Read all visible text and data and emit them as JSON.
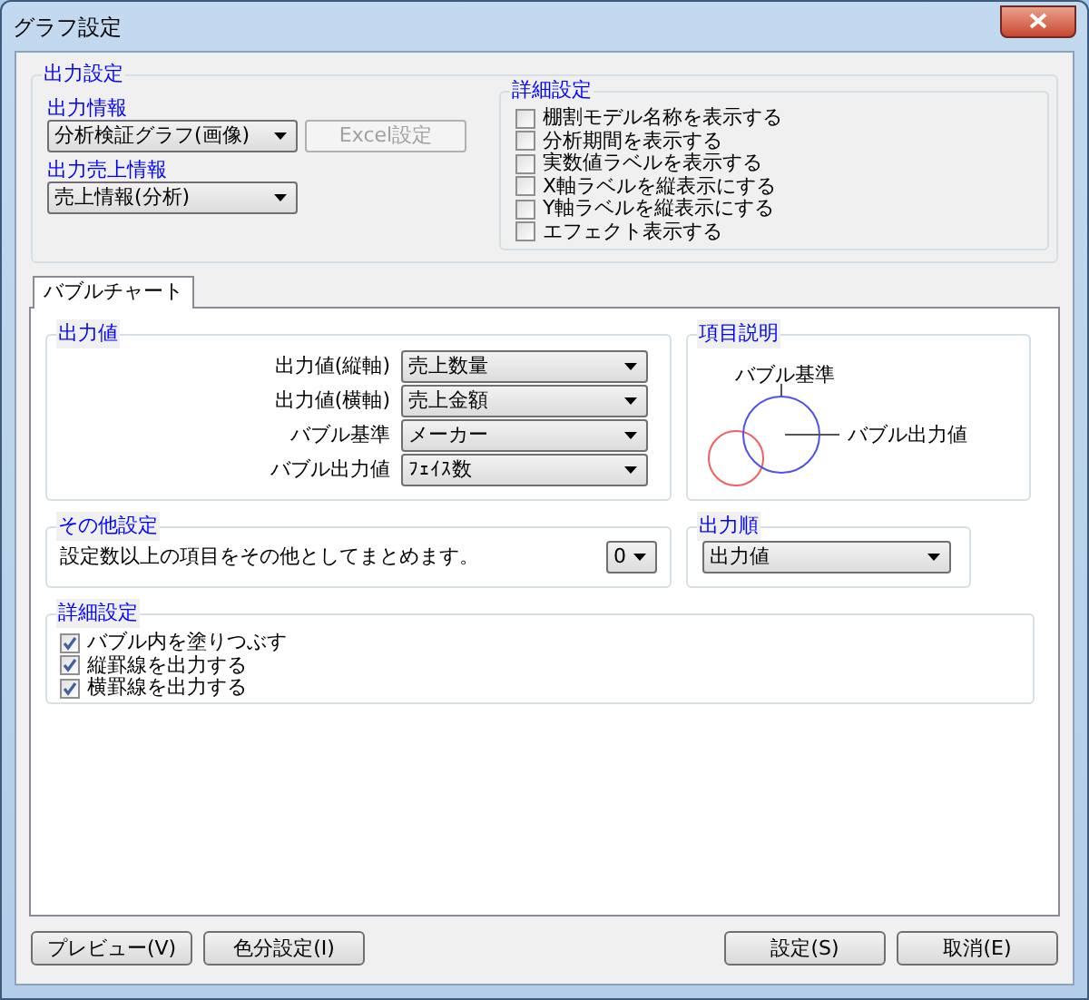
{
  "window": {
    "title": "グラフ設定"
  },
  "output_settings": {
    "title": "出力設定",
    "output_info": {
      "label": "出力情報",
      "value": "分析検証グラフ(画像)"
    },
    "excel_button": {
      "label": "Excel設定",
      "disabled": true
    },
    "sales_info": {
      "label": "出力売上情報",
      "value": "売上情報(分析)"
    },
    "details": {
      "title": "詳細設定",
      "options": [
        {
          "label": "棚割モデル名称を表示する",
          "checked": false
        },
        {
          "label": "分析期間を表示する",
          "checked": false
        },
        {
          "label": "実数値ラベルを表示する",
          "checked": false
        },
        {
          "label": "X軸ラベルを縦表示にする",
          "checked": false
        },
        {
          "label": "Y軸ラベルを縦表示にする",
          "checked": false
        },
        {
          "label": "エフェクト表示する",
          "checked": false
        }
      ]
    }
  },
  "tabs": [
    {
      "label": "バブルチャート",
      "selected": true
    }
  ],
  "output_values": {
    "title": "出力値",
    "fields": [
      {
        "label": "出力値(縦軸)",
        "value": "売上数量"
      },
      {
        "label": "出力値(横軸)",
        "value": "売上金額"
      },
      {
        "label": "バブル基準",
        "value": "メーカー"
      },
      {
        "label": "バブル出力値",
        "value": "ﾌｪｲｽ数"
      }
    ]
  },
  "legend": {
    "title": "項目説明",
    "base_label": "バブル基準",
    "value_label": "バブル出力値"
  },
  "other": {
    "title": "その他設定",
    "text": "設定数以上の項目をその他としてまとめます。",
    "value": "0"
  },
  "order": {
    "title": "出力順",
    "value": "出力値"
  },
  "detail_settings": {
    "title": "詳細設定",
    "options": [
      {
        "label": "バブル内を塗りつぶす",
        "checked": true
      },
      {
        "label": "縦罫線を出力する",
        "checked": true
      },
      {
        "label": "横罫線を出力する",
        "checked": true
      }
    ]
  },
  "buttons_left": [
    "プレビュー(V)",
    "色分設定(I)"
  ],
  "buttons_right": [
    "設定(S)",
    "取消(E)"
  ]
}
